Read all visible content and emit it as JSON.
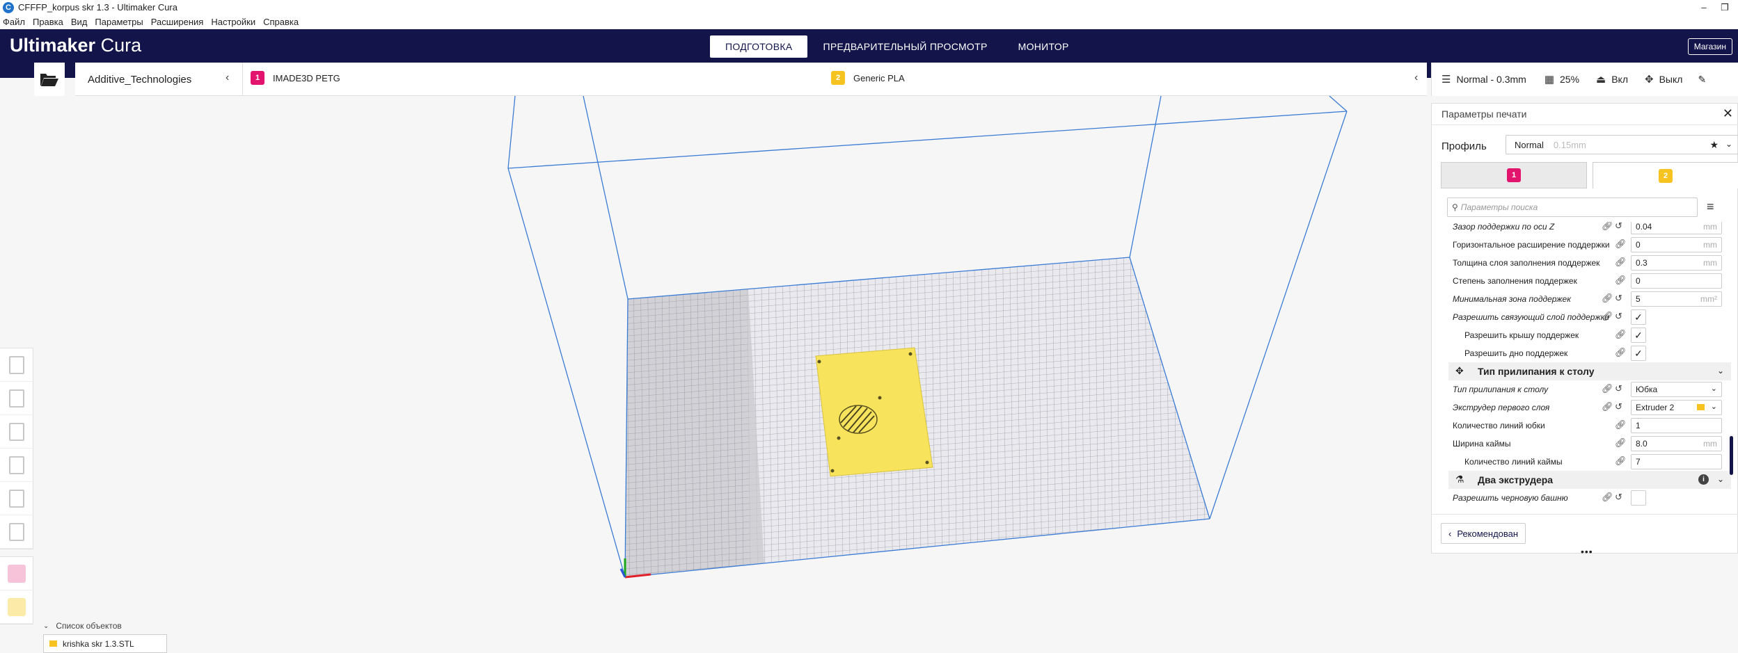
{
  "window": {
    "title": "CFFFP_korpus skr 1.3 - Ultimaker Cura",
    "minimize": "–",
    "restore": "❐"
  },
  "menu": [
    "Файл",
    "Правка",
    "Вид",
    "Параметры",
    "Расширения",
    "Настройки",
    "Справка"
  ],
  "header": {
    "logo_bold": "Ultimaker",
    "logo_light": "Cura",
    "tabs": [
      "ПОДГОТОВКА",
      "ПРЕДВАРИТЕЛЬНЫЙ ПРОСМОТР",
      "МОНИТОР"
    ],
    "active_tab": "ПОДГОТОВКА",
    "marketplace": "Магазин"
  },
  "machine": {
    "name": "Additive_Technologies",
    "extruder1": {
      "number": "1",
      "material": "IMADE3D PETG",
      "color": "#e3146d"
    },
    "extruder2": {
      "number": "2",
      "material": "Generic PLA",
      "color": "#f6c320"
    }
  },
  "print_summary": {
    "profile": "Normal - 0.3mm",
    "infill": "25%",
    "support": "Вкл",
    "adhesion": "Выкл"
  },
  "panel": {
    "title": "Параметры печати",
    "profile_label": "Профиль",
    "profile_value": "Normal",
    "profile_dim": "0.15mm",
    "search_placeholder": "Параметры поиска",
    "recommended": "Рекомендован",
    "settings": [
      {
        "label": "Зазор поддержки по оси Z",
        "italic": true,
        "indent": 0,
        "type": "value",
        "value": "0.04",
        "unit": "mm",
        "reset": true
      },
      {
        "label": "Горизонтальное расширение поддержки",
        "italic": false,
        "indent": 0,
        "type": "value",
        "value": "0",
        "unit": "mm",
        "reset": false
      },
      {
        "label": "Толщина слоя заполнения поддержек",
        "italic": false,
        "indent": 0,
        "type": "value",
        "value": "0.3",
        "unit": "mm",
        "reset": false
      },
      {
        "label": "Степень заполнения поддержек",
        "italic": false,
        "indent": 0,
        "type": "value",
        "value": "0",
        "unit": "",
        "reset": false
      },
      {
        "label": "Минимальная зона поддержек",
        "italic": true,
        "indent": 0,
        "type": "value",
        "value": "5",
        "unit": "mm²",
        "reset": true
      },
      {
        "label": "Разрешить связующий слой поддержки",
        "italic": true,
        "indent": 0,
        "type": "check",
        "checked": true,
        "reset": true
      },
      {
        "label": "Разрешить крышу поддержек",
        "italic": false,
        "indent": 1,
        "type": "check",
        "checked": true,
        "reset": false
      },
      {
        "label": "Разрешить дно поддержек",
        "italic": false,
        "indent": 1,
        "type": "check",
        "checked": true,
        "reset": false
      },
      {
        "category": "Тип прилипания к столу",
        "icon": "adhesion-icon"
      },
      {
        "label": "Тип прилипания к столу",
        "italic": true,
        "indent": 0,
        "type": "select",
        "value": "Юбка",
        "reset": true
      },
      {
        "label": "Экструдер первого слоя",
        "italic": true,
        "indent": 0,
        "type": "extruder",
        "value": "Extruder 2",
        "reset": true
      },
      {
        "label": "Количество линий юбки",
        "italic": false,
        "indent": 0,
        "type": "value",
        "value": "1",
        "unit": "",
        "reset": false
      },
      {
        "label": "Ширина каймы",
        "italic": false,
        "indent": 0,
        "type": "value",
        "value": "8.0",
        "unit": "mm",
        "reset": false
      },
      {
        "label": "Количество линий каймы",
        "italic": false,
        "indent": 1,
        "type": "value",
        "value": "7",
        "unit": "",
        "reset": false
      },
      {
        "category": "Два экструдера",
        "icon": "dual-extruder-icon",
        "info": true
      },
      {
        "label": "Разрешить черновую башню",
        "italic": true,
        "indent": 0,
        "type": "check",
        "checked": false,
        "reset": true
      }
    ]
  },
  "objects": {
    "header": "Список объектов",
    "item": "krishka skr 1.3.STL"
  },
  "colors": {
    "brand": "#13154a",
    "model": "#f8e45c",
    "build_volume": "#3a7bd5"
  }
}
